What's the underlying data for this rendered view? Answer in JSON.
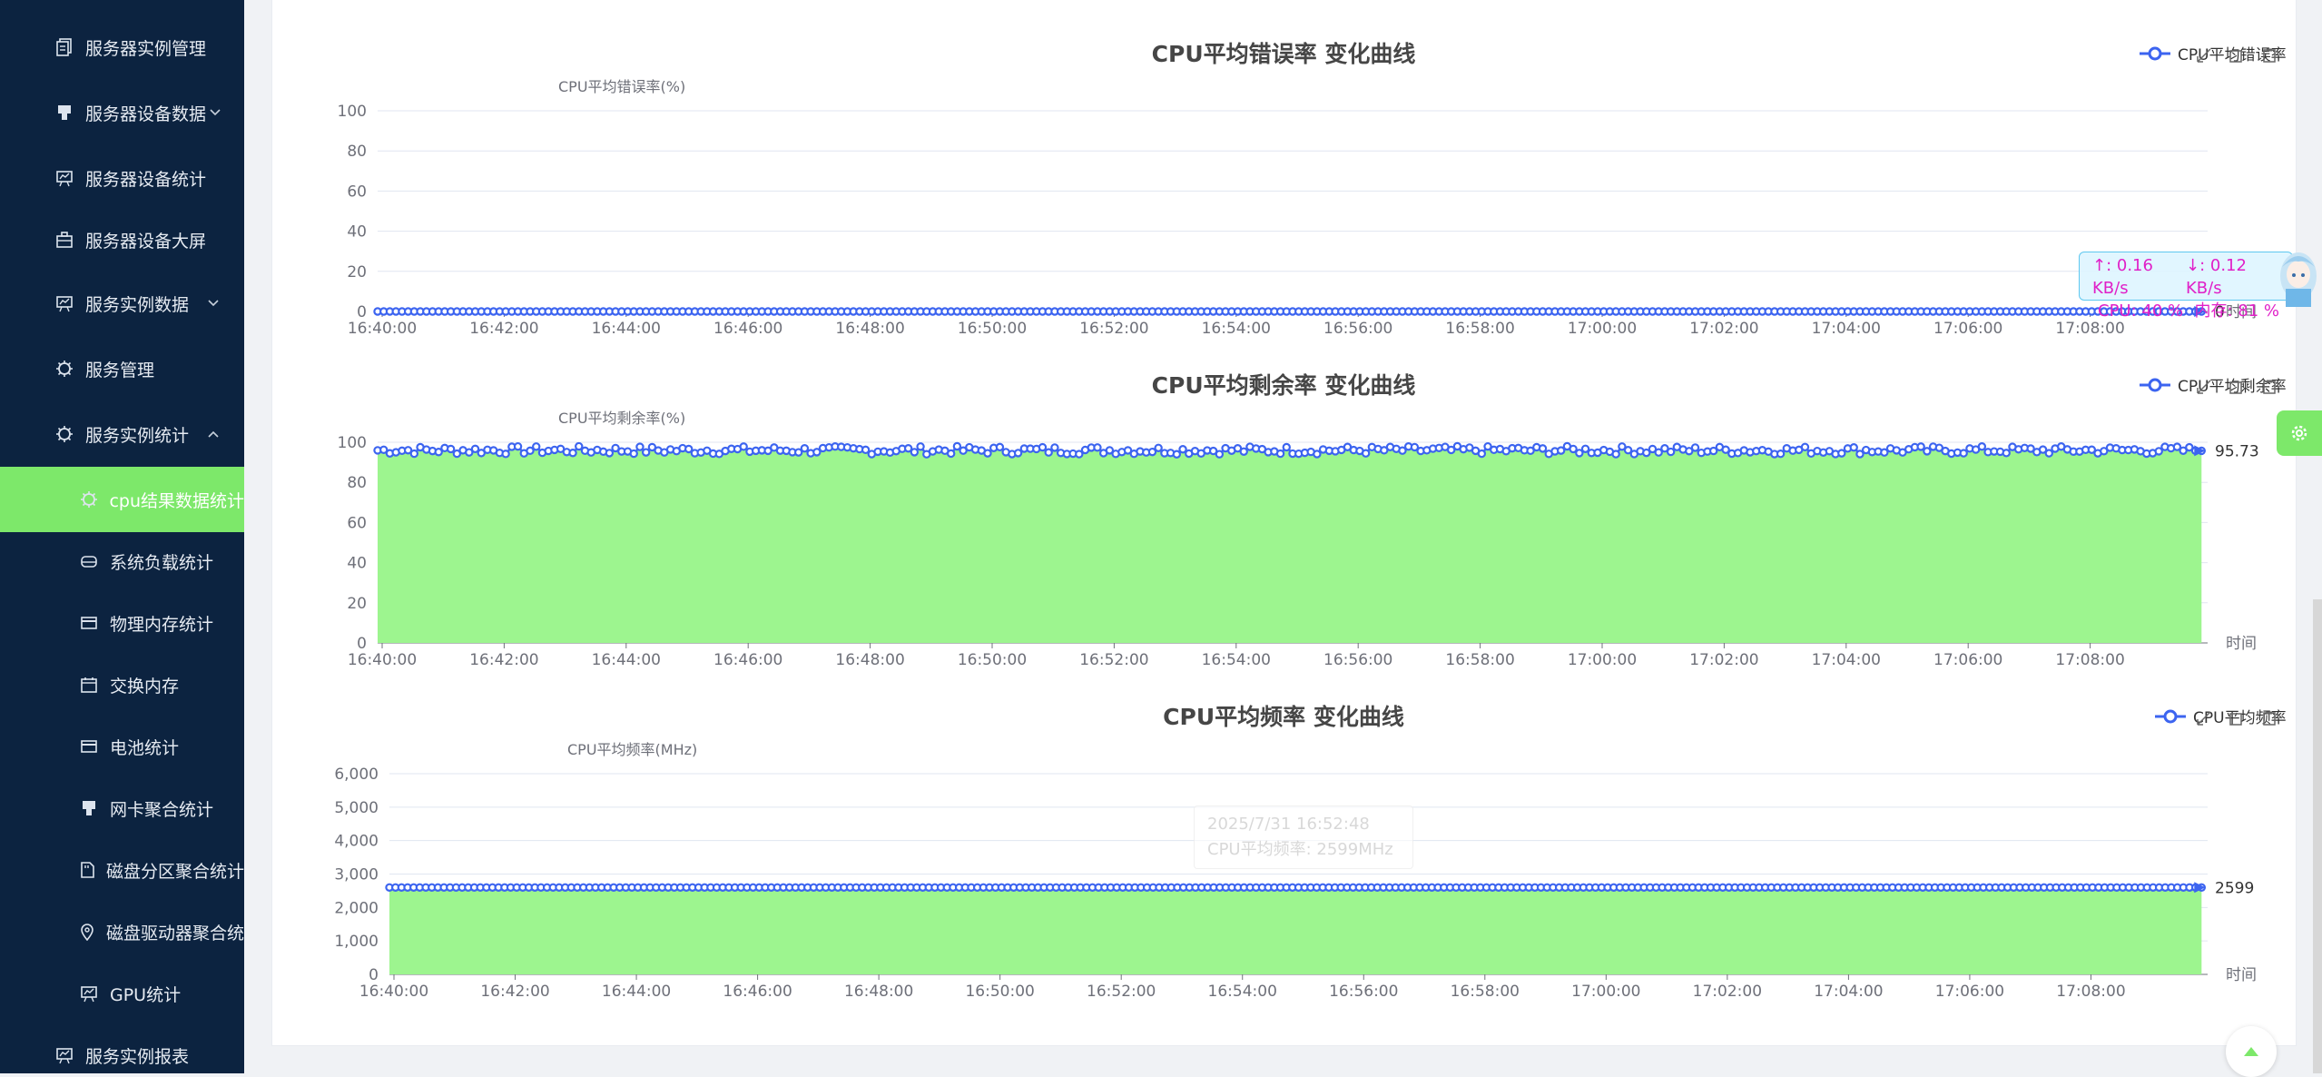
{
  "sidebar": {
    "items": [
      {
        "label": "服务器实例管理",
        "icon": "document-icon",
        "level": 1,
        "arrow": ""
      },
      {
        "label": "服务器设备数据",
        "icon": "server-icon",
        "level": 1,
        "arrow": "chevron-down"
      },
      {
        "label": "服务器设备统计",
        "icon": "presentation-icon",
        "level": 1,
        "arrow": ""
      },
      {
        "label": "服务器设备大屏",
        "icon": "briefcase-icon",
        "level": 1,
        "arrow": ""
      },
      {
        "label": "服务实例数据",
        "icon": "presentation-icon",
        "level": 1,
        "arrow": "chevron-down"
      },
      {
        "label": "服务管理",
        "icon": "cpu-icon",
        "level": 1,
        "arrow": ""
      },
      {
        "label": "服务实例统计",
        "icon": "cpu-icon",
        "level": 1,
        "arrow": "chevron-up"
      },
      {
        "label": "cpu结果数据统计",
        "icon": "cpu-icon",
        "level": 2,
        "arrow": "",
        "active": true
      },
      {
        "label": "系统负载统计",
        "icon": "hard-drive-icon",
        "level": 2,
        "arrow": ""
      },
      {
        "label": "物理内存统计",
        "icon": "card-icon",
        "level": 2,
        "arrow": ""
      },
      {
        "label": "交换内存",
        "icon": "calendar-icon",
        "level": 2,
        "arrow": ""
      },
      {
        "label": "电池统计",
        "icon": "card-icon",
        "level": 2,
        "arrow": ""
      },
      {
        "label": "网卡聚合统计",
        "icon": "server-icon",
        "level": 2,
        "arrow": ""
      },
      {
        "label": "磁盘分区聚合统计",
        "icon": "sd-card-icon",
        "level": 2,
        "arrow": ""
      },
      {
        "label": "磁盘驱动器聚合统计",
        "icon": "location-icon",
        "level": 2,
        "arrow": ""
      },
      {
        "label": "GPU统计",
        "icon": "presentation-icon",
        "level": 2,
        "arrow": ""
      },
      {
        "label": "服务实例报表",
        "icon": "presentation-icon",
        "level": 1,
        "arrow": ""
      }
    ]
  },
  "charts": [
    {
      "title": "CPU平均错误率 变化曲线",
      "legend": "CPU平均错误率"
    },
    {
      "title": "CPU平均剩余率 变化曲线",
      "legend": "CPU平均剩余率"
    },
    {
      "title": "CPU平均频率 变化曲线",
      "legend": "CPU平均频率"
    }
  ],
  "net_widget": {
    "upload": "↑: 0.16 KB/s",
    "download": "↓: 0.12 KB/s",
    "cpu": "CPU: 40 %",
    "memory": "内存: 81 %"
  },
  "tooltip": {
    "time": "2025/7/31 16:52:48",
    "text": "CPU平均频率: 2599MHz"
  },
  "colors": {
    "sidebar_bg": "#0c2340",
    "accent": "#7de86a",
    "series": "#3c64f0",
    "area": "#9df58f"
  },
  "chart_data": [
    {
      "type": "line",
      "title": "CPU平均错误率 变化曲线",
      "ylabel": "CPU平均错误率(%)",
      "xlabel": "时间",
      "ylim": [
        0,
        100
      ],
      "yticks": [
        0,
        20,
        40,
        60,
        80,
        100
      ],
      "xticks": [
        "16:40:00",
        "16:42:00",
        "16:44:00",
        "16:46:00",
        "16:48:00",
        "16:50:00",
        "16:52:00",
        "16:54:00",
        "16:56:00",
        "16:58:00",
        "17:00:00",
        "17:02:00",
        "17:04:00",
        "17:06:00",
        "17:08:00"
      ],
      "x_range": [
        "16:40:00",
        "17:10:00"
      ],
      "series": [
        {
          "name": "CPU平均错误率",
          "constant": 0
        }
      ],
      "end_label": "0",
      "area": false,
      "grid": true,
      "legend_position": "top-right"
    },
    {
      "type": "area",
      "title": "CPU平均剩余率 变化曲线",
      "ylabel": "CPU平均剩余率(%)",
      "xlabel": "时间",
      "ylim": [
        0,
        100
      ],
      "yticks": [
        0,
        20,
        40,
        60,
        80,
        100
      ],
      "xticks": [
        "16:40:00",
        "16:42:00",
        "16:44:00",
        "16:46:00",
        "16:48:00",
        "16:50:00",
        "16:52:00",
        "16:54:00",
        "16:56:00",
        "16:58:00",
        "17:00:00",
        "17:02:00",
        "17:04:00",
        "17:06:00",
        "17:08:00"
      ],
      "x_range": [
        "16:40:00",
        "17:10:00"
      ],
      "series": [
        {
          "name": "CPU平均剩余率",
          "mean": 96,
          "range": [
            94,
            98
          ]
        }
      ],
      "end_label": "95.73",
      "area": true,
      "grid": true,
      "legend_position": "top-right"
    },
    {
      "type": "area",
      "title": "CPU平均频率 变化曲线",
      "ylabel": "CPU平均频率(MHz)",
      "xlabel": "时间",
      "ylim": [
        0,
        6000
      ],
      "yticks": [
        0,
        1000,
        2000,
        3000,
        4000,
        5000,
        6000
      ],
      "ytick_labels": [
        "0",
        "1,000",
        "2,000",
        "3,000",
        "4,000",
        "5,000",
        "6,000"
      ],
      "xticks": [
        "16:40:00",
        "16:42:00",
        "16:44:00",
        "16:46:00",
        "16:48:00",
        "16:50:00",
        "16:52:00",
        "16:54:00",
        "16:56:00",
        "16:58:00",
        "17:00:00",
        "17:02:00",
        "17:04:00",
        "17:06:00",
        "17:08:00"
      ],
      "x_range": [
        "16:40:00",
        "17:10:00"
      ],
      "series": [
        {
          "name": "CPU平均频率",
          "constant": 2599
        }
      ],
      "end_label": "2599",
      "area": true,
      "grid": true,
      "legend_position": "top-right"
    }
  ]
}
